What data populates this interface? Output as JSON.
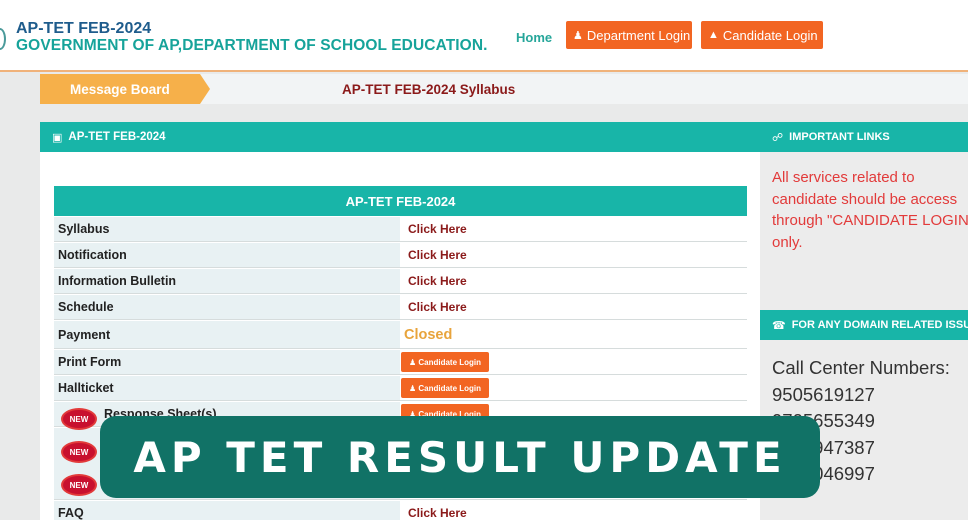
{
  "header": {
    "title": "AP-TET FEB-2024",
    "subtitle": "GOVERNMENT OF AP,DEPARTMENT OF SCHOOL EDUCATION.",
    "nav_home": "Home",
    "dept_login": "Department Login",
    "candidate_login": "Candidate Login"
  },
  "message_board": {
    "label": "Message Board",
    "text": "AP-TET FEB-2024 Syllabus"
  },
  "main": {
    "heading": "AP-TET FEB-2024",
    "table_title": "AP-TET FEB-2024",
    "rows": [
      {
        "label": "Syllabus",
        "value": "Click Here"
      },
      {
        "label": "Notification",
        "value": "Click Here"
      },
      {
        "label": "Information Bulletin",
        "value": "Click Here"
      },
      {
        "label": "Schedule",
        "value": "Click Here"
      },
      {
        "label": "Payment",
        "value": "Closed"
      },
      {
        "label": "Print Form",
        "value": "Candidate Login"
      },
      {
        "label": "Hallticket",
        "value": "Candidate Login"
      },
      {
        "label": "Response Sheet(s)",
        "value": "Candidate Login"
      },
      {
        "label": "FAQ",
        "value": "Click Here"
      }
    ],
    "new_badge": "NEW"
  },
  "sidebar": {
    "important_links_title": "IMPORTANT LINKS",
    "important_text": "All services related to\ncandidate should be access\nthrough \"CANDIDATE LOGIN\"\nonly.",
    "domain_title": "FOR ANY DOMAIN RELATED ISSUES",
    "call_center_title": "Call Center Numbers:",
    "numbers": [
      "9505619127",
      "9705655349",
      "8121947387",
      "8125046997"
    ]
  },
  "banner": {
    "text": "AP TET RESULT UPDATE"
  },
  "colors": {
    "teal": "#18b5a8",
    "orange": "#f26522",
    "banner": "#117266",
    "link": "#8b1a1a",
    "warning": "#e23a3a"
  },
  "icons": [
    "user-icon",
    "graduation-cap-icon",
    "id-card-icon",
    "link-icon",
    "phone-icon"
  ]
}
